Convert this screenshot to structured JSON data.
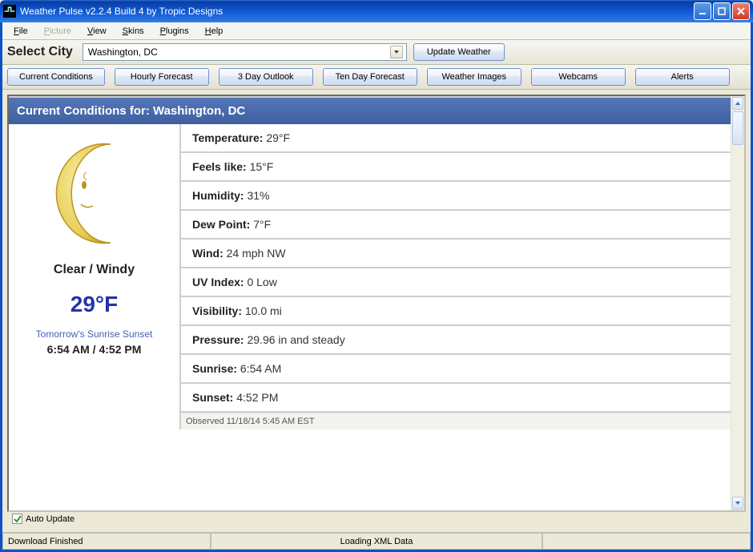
{
  "window": {
    "title": "Weather Pulse v2.2.4 Build 4 by Tropic Designs"
  },
  "menu": {
    "file": "File",
    "picture": "Picture",
    "view": "View",
    "skins": "Skins",
    "plugins": "Plugins",
    "help": "Help"
  },
  "city_picker": {
    "label": "Select City",
    "selected": "Washington, DC",
    "update_button": "Update Weather"
  },
  "tabs": {
    "current": "Current Conditions",
    "hourly": "Hourly Forecast",
    "three_day": "3 Day Outlook",
    "ten_day": "Ten Day Forecast",
    "images": "Weather Images",
    "webcams": "Webcams",
    "alerts": "Alerts"
  },
  "conditions": {
    "header": "Current Conditions for: Washington, DC",
    "summary": "Clear / Windy",
    "big_temp": "29°F",
    "sun_label": "Tomorrow's Sunrise Sunset",
    "sun_times": "6:54 AM / 4:52 PM",
    "metrics": {
      "temperature_label": "Temperature:",
      "temperature_value": "29°F",
      "feels_label": "Feels like:",
      "feels_value": "15°F",
      "humidity_label": "Humidity:",
      "humidity_value": "31%",
      "dew_label": "Dew Point:",
      "dew_value": "7°F",
      "wind_label": "Wind:",
      "wind_value": "24 mph NW",
      "uv_label": "UV Index:",
      "uv_value": "0 Low",
      "visibility_label": "Visibility:",
      "visibility_value": "10.0 mi",
      "pressure_label": "Pressure:",
      "pressure_value": "29.96 in and steady",
      "sunrise_label": "Sunrise:",
      "sunrise_value": "6:54 AM",
      "sunset_label": "Sunset:",
      "sunset_value": "4:52 PM"
    },
    "observed": "Observed 11/18/14 5:45 AM EST"
  },
  "auto_update_label": "Auto Update",
  "status": {
    "left": "Download Finished",
    "center": "Loading XML Data"
  }
}
